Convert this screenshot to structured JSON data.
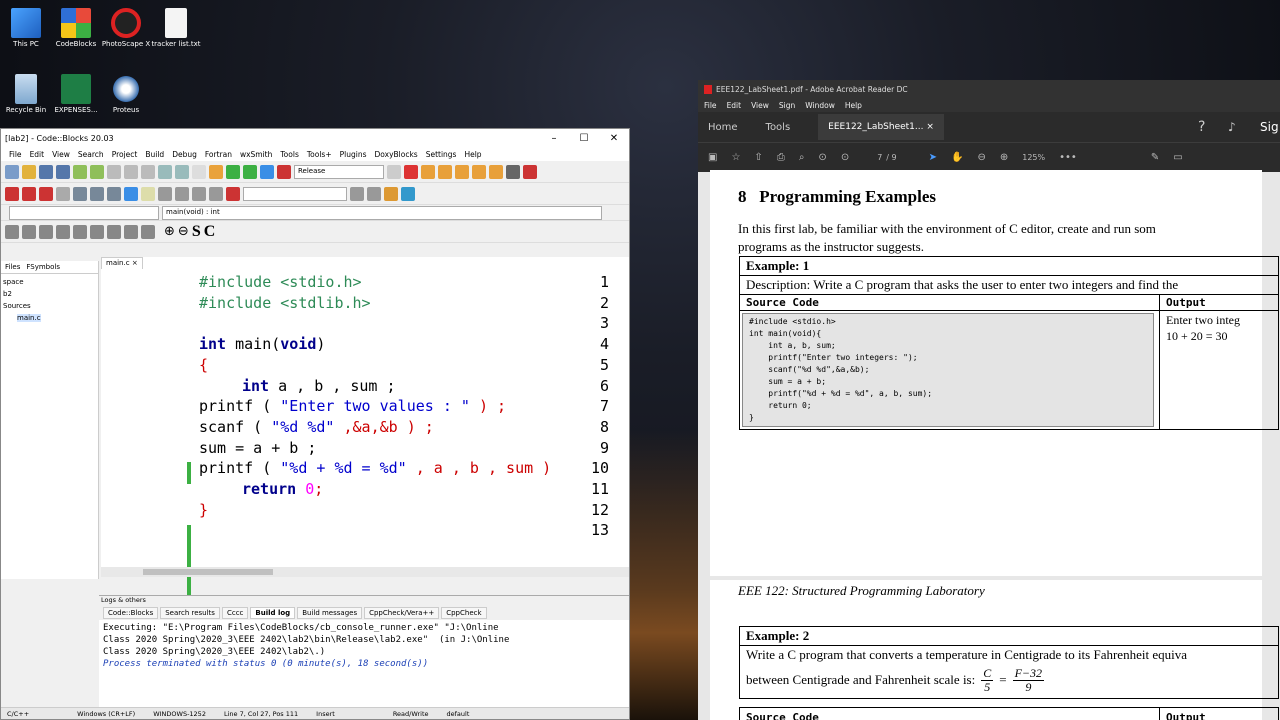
{
  "desktop": {
    "icons": [
      {
        "label": "This PC",
        "color": "#3a8ee6",
        "icon": "computer-icon"
      },
      {
        "label": "CodeBlocks",
        "color": "#e84a3a",
        "icon": "codeblocks-icon"
      },
      {
        "label": "PhotoScape X",
        "color": "#d22",
        "icon": "photoscape-icon"
      },
      {
        "label": "tracker list.txt",
        "color": "#eee",
        "icon": "text-file-icon"
      },
      {
        "label": "Recycle Bin",
        "color": "#9bc4e8",
        "icon": "recycle-bin-icon"
      },
      {
        "label": "EXPENSES...",
        "color": "#1e7e45",
        "icon": "excel-icon"
      },
      {
        "label": "Proteus",
        "color": "#ccc",
        "icon": "proteus-icon"
      }
    ]
  },
  "codeblocks": {
    "title": "[lab2] - Code::Blocks 20.03",
    "menu": [
      "File",
      "Edit",
      "View",
      "Search",
      "Project",
      "Build",
      "Debug",
      "Fortran",
      "wxSmith",
      "Tools",
      "Tools+",
      "Plugins",
      "DoxyBlocks",
      "Settings",
      "Help"
    ],
    "build_target": "Release",
    "scope_combo": "main(void) : int",
    "left_tabs": [
      "Files",
      "FSymbols"
    ],
    "tree": [
      "space",
      "b2",
      "Sources",
      "main.c"
    ],
    "editor_tab": "main.c",
    "line_numbers": [
      "1",
      "2",
      "3",
      "4",
      "5",
      "6",
      "7",
      "8",
      "9",
      "10",
      "11",
      "12",
      "13"
    ],
    "code": {
      "l1": "#include <stdio.h>",
      "l2": "#include <stdlib.h>",
      "l4_kw": "int",
      "l4_rest": " main(",
      "l4_kw2": "void",
      "l4_end": ")",
      "l5": "{",
      "l6_kw": "int",
      "l6_rest": " a , b , sum ;",
      "l7_a": "printf ( ",
      "l7_s": "\"Enter two values : \"",
      "l7_b": " ) ;",
      "l8_a": "scanf ( ",
      "l8_s": "\"%d %d\"",
      "l8_b": " ,&a,&b ) ;",
      "l9": "sum = a + b ;",
      "l10_a": "printf ( ",
      "l10_s": "\"%d + %d = %d\"",
      "l10_b": " , a , b , sum )",
      "l11_kw": "return",
      "l11_num": "0",
      "l11_end": ";",
      "l12": "}"
    },
    "logs_title": "Logs & others",
    "log_tabs": [
      "Code::Blocks",
      "Search results",
      "Cccc",
      "Build log",
      "Build messages",
      "CppCheck/Vera++",
      "CppCheck"
    ],
    "log_lines": [
      "Executing: \"E:\\Program Files\\CodeBlocks/cb_console_runner.exe\" \"J:\\Online",
      "Class 2020 Spring\\2020_3\\EEE 2402\\lab2\\bin\\Release\\lab2.exe\"  (in J:\\Online",
      "Class 2020 Spring\\2020_3\\EEE 2402\\lab2\\.)"
    ],
    "log_status": "Process terminated with status 0 (0 minute(s), 18 second(s))",
    "status_bar": [
      "C/C++",
      "Windows (CR+LF)",
      "WINDOWS-1252",
      "Line 7, Col 27, Pos 111",
      "Insert",
      "Read/Write",
      "default"
    ]
  },
  "acrobat": {
    "title": "EEE122_LabSheet1.pdf - Adobe Acrobat Reader DC",
    "menu": [
      "File",
      "Edit",
      "View",
      "Sign",
      "Window",
      "Help"
    ],
    "tabs": [
      "Home",
      "Tools"
    ],
    "doc_tab": "EEE122_LabSheet1...",
    "sign": "Sig",
    "page_current": "7",
    "page_total": "/ 9",
    "zoom": "125%",
    "heading_num": "8",
    "heading": "Programming Examples",
    "intro_1": "In this first lab, be familiar with the environment of C editor, create and run som",
    "intro_2": "programs as the instructor suggests.",
    "ex1_title": "Example: 1",
    "ex1_desc": "Description: Write a C program that asks the user to enter two integers and find the",
    "source_code_label": "Source Code",
    "output_label": "Output",
    "ex1_code": [
      "#include <stdio.h>",
      "int main(void){",
      "    int a, b, sum;",
      "    printf(\"Enter two integers: \");",
      "    scanf(\"%d %d\",&a,&b);",
      "    sum = a + b;",
      "    printf(\"%d + %d = %d\", a, b, sum);",
      "    return 0;",
      "}"
    ],
    "ex1_out_1": "Enter two integ",
    "ex1_out_2": "10 + 20 = 30",
    "footer": "EEE 122: Structured Programming Laboratory",
    "ex2_title": "Example: 2",
    "ex2_desc_1": "Write a C program that converts a temperature in Centigrade to its Fahrenheit equiva",
    "ex2_desc_2": "between Centigrade and Fahrenheit scale is:",
    "formula_c": "C",
    "formula_5": "5",
    "formula_f": "F−32",
    "formula_9": "9",
    "formula_eq": "="
  }
}
